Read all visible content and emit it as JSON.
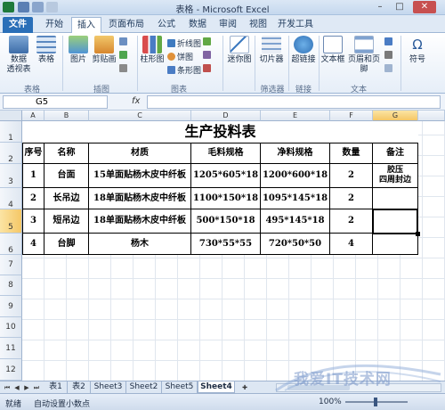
{
  "window": {
    "title": "表格 - Microsoft Excel",
    "minimize": "–",
    "maximize": "□",
    "close": "✕"
  },
  "ribbon_tabs": [
    "文件",
    "开始",
    "插入",
    "页面布局",
    "公式",
    "数据",
    "审阅",
    "视图",
    "开发工具"
  ],
  "ribbon": {
    "table_group": {
      "label": "表格",
      "pivot": "数据\n透视表",
      "table": "表格"
    },
    "illustration_group": {
      "label": "插图",
      "picture": "图片",
      "clipart": "剪贴画"
    },
    "charts_group": {
      "label": "图表",
      "column": "柱形图",
      "line": "折线图",
      "pie": "饼图",
      "bar": "条形图"
    },
    "sparkline_group": {
      "label": "",
      "sparkline": "迷你图"
    },
    "filter_group": {
      "label": "筛选器",
      "slicer": "切片器"
    },
    "link_group": {
      "label": "链接",
      "hyperlink": "超链接"
    },
    "text_group": {
      "label": "文本",
      "textbox": "文本框",
      "header": "页眉和页脚"
    },
    "symbol_group": {
      "symbol": "符号"
    }
  },
  "formula_bar": {
    "name_box": "G5",
    "fx": "fx",
    "formula": ""
  },
  "columns": [
    "A",
    "B",
    "C",
    "D",
    "E",
    "F",
    "G"
  ],
  "rows": [
    "1",
    "2",
    "3",
    "4",
    "5",
    "6",
    "7",
    "8",
    "9",
    "10",
    "11",
    "12"
  ],
  "sheet": {
    "title": "生产投料表",
    "headers": [
      "序号",
      "名称",
      "材质",
      "毛料规格",
      "净料规格",
      "数量",
      "备注"
    ],
    "data": [
      [
        "1",
        "台面",
        "15单面贴杨木皮中纤板",
        "1205*605*18",
        "1200*600*18",
        "2",
        "胶压\n四周封边"
      ],
      [
        "2",
        "长吊边",
        "18单面贴杨木皮中纤板",
        "1100*150*18",
        "1095*145*18",
        "2",
        ""
      ],
      [
        "3",
        "短吊边",
        "18单面贴杨木皮中纤板",
        "500*150*18",
        "495*145*18",
        "2",
        ""
      ],
      [
        "4",
        "台脚",
        "杨木",
        "730*55*55",
        "720*50*50",
        "4",
        ""
      ]
    ]
  },
  "sheet_tabs": [
    "表1",
    "表2",
    "Sheet3",
    "Sheet2",
    "Sheet5",
    "Sheet4"
  ],
  "active_sheet": "Sheet4",
  "status": {
    "ready": "就绪",
    "mode": "自动设置小数点",
    "zoom": "100%"
  },
  "watermark": "我爱IT技术网",
  "colors": {
    "file_tab": "#2a6fb8",
    "selection_header": "#f5c766",
    "grid_line": "#e0e6ee"
  }
}
